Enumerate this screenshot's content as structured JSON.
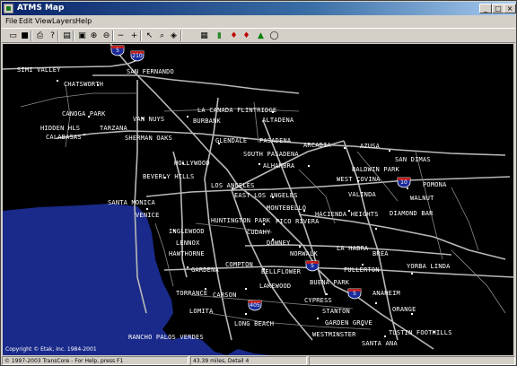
{
  "window": {
    "title": "ATMS Map"
  },
  "menubar": {
    "items": [
      "File",
      "Edit",
      "View",
      "Layers",
      "Help"
    ]
  },
  "toolbar": {
    "buttons": [
      {
        "name": "open-folder-icon",
        "glyph": "▭"
      },
      {
        "name": "save-icon",
        "glyph": "■"
      },
      {
        "name": "print-icon",
        "glyph": "⎙"
      },
      {
        "name": "info-icon",
        "glyph": "?"
      },
      {
        "name": "layer-list-icon",
        "glyph": "▤"
      },
      {
        "name": "zoom-extent-icon",
        "glyph": "▣"
      },
      {
        "name": "zoom-in-icon",
        "glyph": "⊕"
      },
      {
        "name": "zoom-out-icon",
        "glyph": "⊖"
      },
      {
        "name": "minus-icon",
        "glyph": "−"
      },
      {
        "name": "plus-icon",
        "glyph": "+"
      },
      {
        "name": "pointer-icon",
        "glyph": "↖"
      },
      {
        "name": "find-icon",
        "glyph": "⌕"
      },
      {
        "name": "identify-icon",
        "glyph": "◈"
      },
      {
        "name": "grid-icon",
        "glyph": "▦"
      },
      {
        "name": "signal-icon",
        "glyph": "▮"
      },
      {
        "name": "cms-icon",
        "glyph": "♦"
      },
      {
        "name": "incident-icon",
        "glyph": "♦"
      },
      {
        "name": "triangle-icon",
        "glyph": "▲"
      },
      {
        "name": "balloon-icon",
        "glyph": "◯"
      }
    ]
  },
  "map": {
    "cities": [
      "SIMI VALLEY",
      "SAN FERNANDO",
      "CHATSWORTH",
      "LA CANADA FLINTRIDGE",
      "CANOGA PARK",
      "VAN NUYS",
      "BURBANK",
      "ALTADENA",
      "HIDDEN HLS",
      "TARZANA",
      "CALABASAS",
      "SHERMAN OAKS",
      "GLENDALE",
      "PASADENA",
      "ARCADIA",
      "AZUSA",
      "SOUTH PASADENA",
      "ALHAMBRA",
      "SAN DIMAS",
      "HOLLYWOOD",
      "BEVERLY HILLS",
      "BALDWIN PARK",
      "WEST COVINA",
      "POMONA",
      "LOS ANGELES",
      "EAST LOS ANGELES",
      "WALNUT",
      "VALINDA",
      "SANTA MONICA",
      "VENICE",
      "MONTEBELLO",
      "HACIENDA HEIGHTS",
      "DIAMOND BAR",
      "HUNTINGTON PARK",
      "PICO RIVERA",
      "INGLEWOOD",
      "CUDAHY",
      "LENNOX",
      "DOWNEY",
      "HAWTHORNE",
      "NORWALK",
      "LA HABRA",
      "BREA",
      "COMPTON",
      "GARDENA",
      "BELLFLOWER",
      "FULLERTON",
      "YORBA LINDA",
      "TORRANCE",
      "LAKEWOOD",
      "CARSON",
      "BUENA PARK",
      "CYPRESS",
      "ANAHEIM",
      "LOMITA",
      "ORANGE",
      "STANTON",
      "LONG BEACH",
      "GARDEN GROVE",
      "RANCHO PALOS VERDES",
      "WESTMINSTER",
      "TUSTIN FOOTHILLS",
      "SANTA ANA"
    ],
    "shields": [
      "5",
      "210",
      "10",
      "5",
      "405",
      "5"
    ],
    "copyright": "Copyright © Etak, Inc. 1984-2001"
  },
  "statusbar": {
    "help": "© 1997-2003 TransCore - For Help, press F1",
    "scale": "43.39 miles, Detail 4"
  },
  "colors": {
    "map_bg": "#000000",
    "ocean": "#1a2a8a",
    "road": "#b8b8b8",
    "label": "#ffffff"
  }
}
